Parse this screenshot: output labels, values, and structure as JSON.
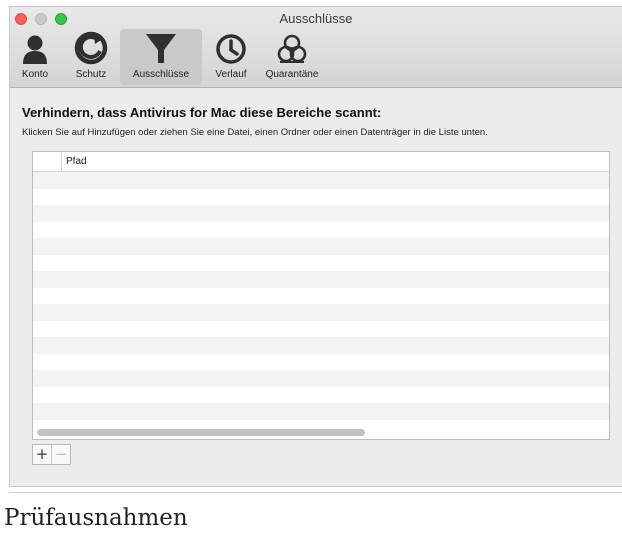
{
  "window": {
    "title": "Ausschlüsse"
  },
  "toolbar": {
    "items": [
      {
        "label": "Konto",
        "icon": "user-icon"
      },
      {
        "label": "Schutz",
        "icon": "shield-refresh-icon"
      },
      {
        "label": "Ausschlüsse",
        "icon": "filter-icon",
        "selected": true
      },
      {
        "label": "Verlauf",
        "icon": "clock-icon"
      },
      {
        "label": "Quarantäne",
        "icon": "biohazard-icon"
      }
    ]
  },
  "main": {
    "heading": "Verhindern, dass Antivirus for Mac diese Bereiche scannt:",
    "description": "Klicken Sie auf Hinzufügen oder ziehen Sie eine Datei, einen Ordner oder einen Datenträger in die Liste unten.",
    "table": {
      "columns": [
        "",
        "Pfad"
      ],
      "rows": []
    },
    "buttons": {
      "add": "+",
      "remove": "−"
    }
  },
  "caption": "Prüfausnahmen",
  "colors": {
    "window_bg": "#ececec",
    "selected_toolbar_bg": "#c9c9c9",
    "close": "#fc605c",
    "maximize": "#34c84a"
  }
}
